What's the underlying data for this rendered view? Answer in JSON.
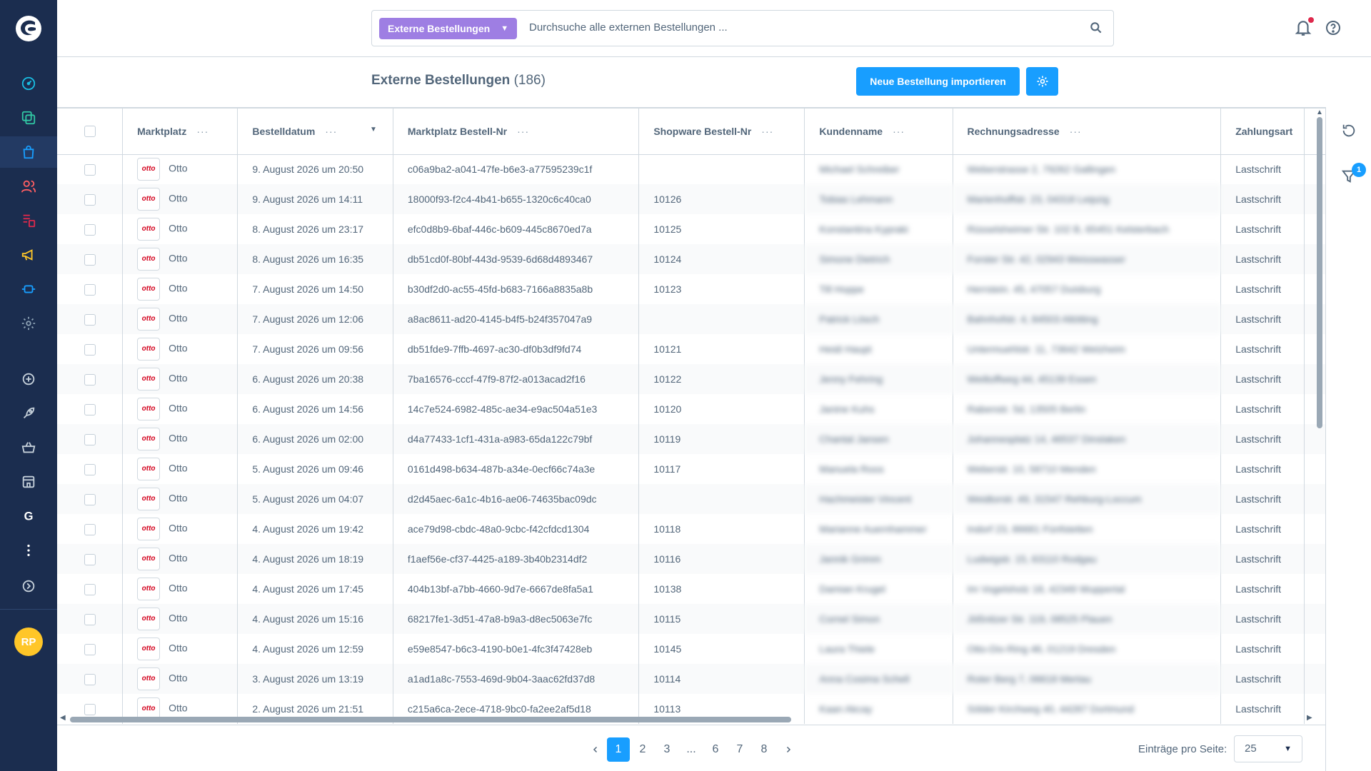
{
  "search": {
    "type_label": "Externe Bestellungen",
    "placeholder": "Durchsuche alle externen Bestellungen ..."
  },
  "user": {
    "initials": "RP"
  },
  "header": {
    "title": "Externe Bestellungen",
    "count": "(186)",
    "import_button": "Neue Bestellung importieren"
  },
  "columns": [
    "Marktplatz",
    "Bestelldatum",
    "Marktplatz Bestell-Nr",
    "Shopware Bestell-Nr",
    "Kundenname",
    "Rechnungsadresse",
    "Zahlungsart"
  ],
  "rows": [
    {
      "marketplace": "Otto",
      "date": "9. August 2026 um 20:50",
      "mp_nr": "c06a9ba2-a041-47fe-b6e3-a77595239c1f",
      "sw_nr": "",
      "customer": "Michael Schreiber",
      "address": "Weberstrasse 2, 79262 Gallingen",
      "payment": "Lastschrift"
    },
    {
      "marketplace": "Otto",
      "date": "9. August 2026 um 14:11",
      "mp_nr": "18000f93-f2c4-4b41-b655-1320c6c40ca0",
      "sw_nr": "10126",
      "customer": "Tobias Lehmann",
      "address": "Marienhoffstr. 23, 04318 Leipzig",
      "payment": "Lastschrift"
    },
    {
      "marketplace": "Otto",
      "date": "8. August 2026 um 23:17",
      "mp_nr": "efc0d8b9-6baf-446c-b609-445c8670ed7a",
      "sw_nr": "10125",
      "customer": "Konstantina Kypraki",
      "address": "Rüsselsheimer Str. 102 B, 65451 Kelsterbach",
      "payment": "Lastschrift"
    },
    {
      "marketplace": "Otto",
      "date": "8. August 2026 um 16:35",
      "mp_nr": "db51cd0f-80bf-443d-9539-6d68d4893467",
      "sw_nr": "10124",
      "customer": "Simone Dietrich",
      "address": "Forster Str. 42, 02943 Weisswasser",
      "payment": "Lastschrift"
    },
    {
      "marketplace": "Otto",
      "date": "7. August 2026 um 14:50",
      "mp_nr": "b30df2d0-ac55-45fd-b683-7166a8835a8b",
      "sw_nr": "10123",
      "customer": "Till Hoppe",
      "address": "Herrstein. 45, 47057 Duisburg",
      "payment": "Lastschrift"
    },
    {
      "marketplace": "Otto",
      "date": "7. August 2026 um 12:06",
      "mp_nr": "a8ac8611-ad20-4145-b4f5-b24f357047a9",
      "sw_nr": "",
      "customer": "Patrick Lösch",
      "address": "Bahnhofstr. 4, 84503 Altötting",
      "payment": "Lastschrift"
    },
    {
      "marketplace": "Otto",
      "date": "7. August 2026 um 09:56",
      "mp_nr": "db51fde9-7ffb-4697-ac30-df0b3df9fd74",
      "sw_nr": "10121",
      "customer": "Heidi Haupt",
      "address": "Untermuehlstr. 11, 73642 Welzheim",
      "payment": "Lastschrift"
    },
    {
      "marketplace": "Otto",
      "date": "6. August 2026 um 20:38",
      "mp_nr": "7ba16576-cccf-47f9-87f2-a013acad2f16",
      "sw_nr": "10122",
      "customer": "Jenny Fehring",
      "address": "Weiltoffweg 44, 45139 Essen",
      "payment": "Lastschrift"
    },
    {
      "marketplace": "Otto",
      "date": "6. August 2026 um 14:56",
      "mp_nr": "14c7e524-6982-485c-ae34-e9ac504a51e3",
      "sw_nr": "10120",
      "customer": "Janine Kuhs",
      "address": "Rabenstr. 5d, 13505 Berlin",
      "payment": "Lastschrift"
    },
    {
      "marketplace": "Otto",
      "date": "6. August 2026 um 02:00",
      "mp_nr": "d4a77433-1cf1-431a-a983-65da122c79bf",
      "sw_nr": "10119",
      "customer": "Chantal Jansen",
      "address": "Johannesplatz 14, 46537 Dinslaken",
      "payment": "Lastschrift"
    },
    {
      "marketplace": "Otto",
      "date": "5. August 2026 um 09:46",
      "mp_nr": "0161d498-b634-487b-a34e-0ecf66c74a3e",
      "sw_nr": "10117",
      "customer": "Manuela Roos",
      "address": "Weberstr. 10, 58710 Menden",
      "payment": "Lastschrift"
    },
    {
      "marketplace": "Otto",
      "date": "5. August 2026 um 04:07",
      "mp_nr": "d2d45aec-6a1c-4b16-ae06-74635bac09dc",
      "sw_nr": "",
      "customer": "Hachmeister Vincent",
      "address": "Weidtorstr. 49, 31547 Rehburg-Loccum",
      "payment": "Lastschrift"
    },
    {
      "marketplace": "Otto",
      "date": "4. August 2026 um 19:42",
      "mp_nr": "ace79d98-cbdc-48a0-9cbc-f42cfdcd1304",
      "sw_nr": "10118",
      "customer": "Marianne Auernhammer",
      "address": "Indorf 23, 86681 Fünfstetten",
      "payment": "Lastschrift"
    },
    {
      "marketplace": "Otto",
      "date": "4. August 2026 um 18:19",
      "mp_nr": "f1aef56e-cf37-4425-a189-3b40b2314df2",
      "sw_nr": "10116",
      "customer": "Jannik Grimm",
      "address": "Ludwigstr. 15, 63110 Rodgau",
      "payment": "Lastschrift"
    },
    {
      "marketplace": "Otto",
      "date": "4. August 2026 um 17:45",
      "mp_nr": "404b13bf-a7bb-4660-9d7e-6667de8fa5a1",
      "sw_nr": "10138",
      "customer": "Damian Krugel",
      "address": "Im Vogelsholz 18, 42349 Wuppertal",
      "payment": "Lastschrift"
    },
    {
      "marketplace": "Otto",
      "date": "4. August 2026 um 15:16",
      "mp_nr": "68217fe1-3d51-47a8-b9a3-d8ec5063e7fc",
      "sw_nr": "10115",
      "customer": "Cornel Simon",
      "address": "Jößnitzer Str. 119, 08525 Plauen",
      "payment": "Lastschrift"
    },
    {
      "marketplace": "Otto",
      "date": "4. August 2026 um 12:59",
      "mp_nr": "e59e8547-b6c3-4190-b0e1-4fc3f47428eb",
      "sw_nr": "10145",
      "customer": "Laura Thiele",
      "address": "Otto-Dix-Ring 46, 01219 Dresden",
      "payment": "Lastschrift"
    },
    {
      "marketplace": "Otto",
      "date": "3. August 2026 um 13:19",
      "mp_nr": "a1ad1a8c-7553-469d-9b04-3aac62fd37d8",
      "sw_nr": "10114",
      "customer": "Anna Cosima Schell",
      "address": "Roter Berg 7, 06618 Mertau",
      "payment": "Lastschrift"
    },
    {
      "marketplace": "Otto",
      "date": "2. August 2026 um 21:51",
      "mp_nr": "c215a6ca-2ece-4718-9bc0-fa2ee2af5d18",
      "sw_nr": "10113",
      "customer": "Kaan Akcay",
      "address": "Sölder Kirchweg 40, 44287 Dortmund",
      "payment": "Lastschrift"
    }
  ],
  "filter_badge": "1",
  "pagination": {
    "pages": [
      "1",
      "2",
      "3",
      "...",
      "6",
      "7",
      "8"
    ],
    "active": "1",
    "per_page_label": "Einträge pro Seite:",
    "per_page_value": "25"
  },
  "colors": {
    "sidebar": "#1b2d4f",
    "primary": "#189eff",
    "search_type": "#9e7ee3",
    "avatar": "#ffc628",
    "otto_red": "#d4021d",
    "nav_icons": [
      "#19bde2",
      "#31c8a4",
      "#189eff",
      "#ff5e62",
      "#de294c",
      "#ffc628",
      "#189eff",
      "#8da2b5"
    ]
  },
  "icons": {
    "sidebar": [
      "dashboard-icon",
      "catalogue-icon",
      "orders-icon",
      "customers-icon",
      "content-icon",
      "marketing-icon",
      "extensions-icon",
      "settings-icon",
      "add-channel-icon",
      "rocket-icon",
      "basket-icon",
      "store-icon",
      "google-icon",
      "more-icon",
      "collapse-icon"
    ]
  }
}
